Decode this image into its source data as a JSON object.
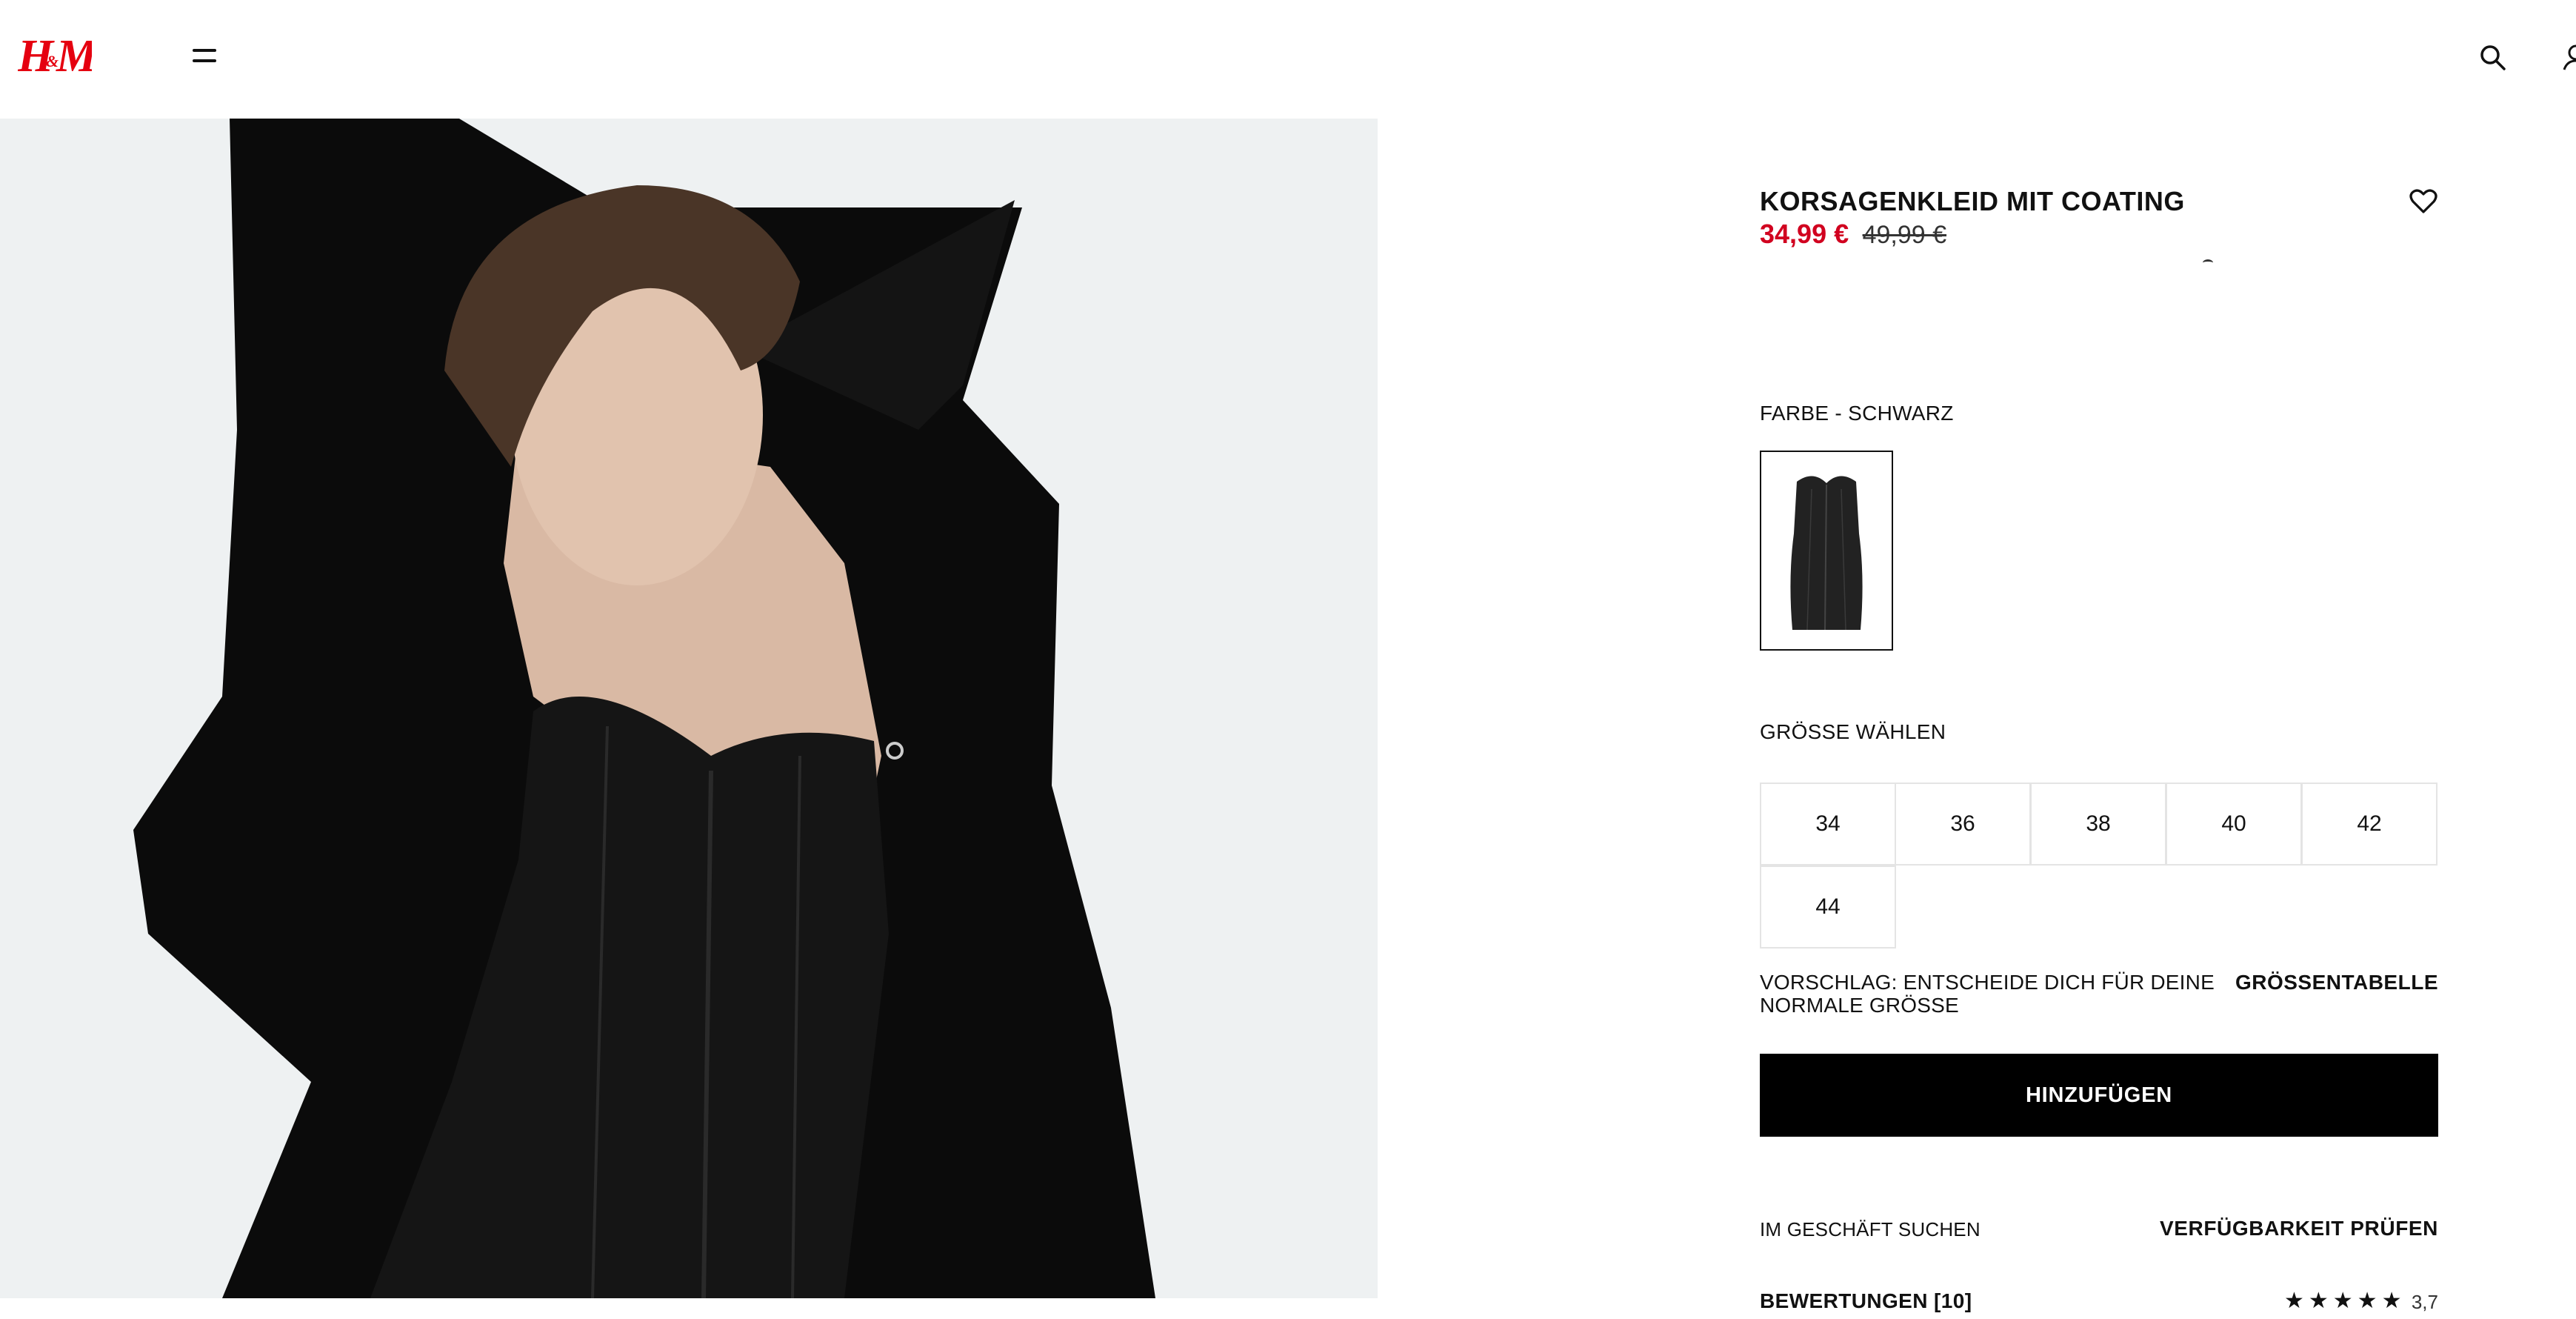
{
  "header": {
    "logo_text": "H&M",
    "menu_icon": "hamburger-menu-icon",
    "search_icon": "search-icon",
    "account_icon": "user-icon"
  },
  "product": {
    "title": "KORSAGENKLEID MIT COATING",
    "price_sale": "34,99 €",
    "price_original": "49,99 €",
    "favorite_icon": "heart-icon",
    "color_label": "FARBE - SCHWARZ",
    "size_label": "GRÖSSE WÄHLEN",
    "sizes": [
      "34",
      "36",
      "38",
      "40",
      "42",
      "44"
    ],
    "size_advice": "VORSCHLAG: ENTSCHEIDE DICH FÜR DEINE NORMALE GRÖSSE",
    "size_chart_label": "GRÖSSENTABELLE",
    "add_button_label": "HINZUFÜGEN",
    "store_label": "IM GESCHÄFT SUCHEN",
    "availability_label": "VERFÜGBARKEIT PRÜFEN",
    "reviews_label": "BEWERTUNGEN [10]",
    "rating_stars": "★★★★★",
    "rating_value": "3,7"
  },
  "colors": {
    "sale_red": "#d1001f",
    "brand_red": "#e50010",
    "button_black": "#000000"
  }
}
